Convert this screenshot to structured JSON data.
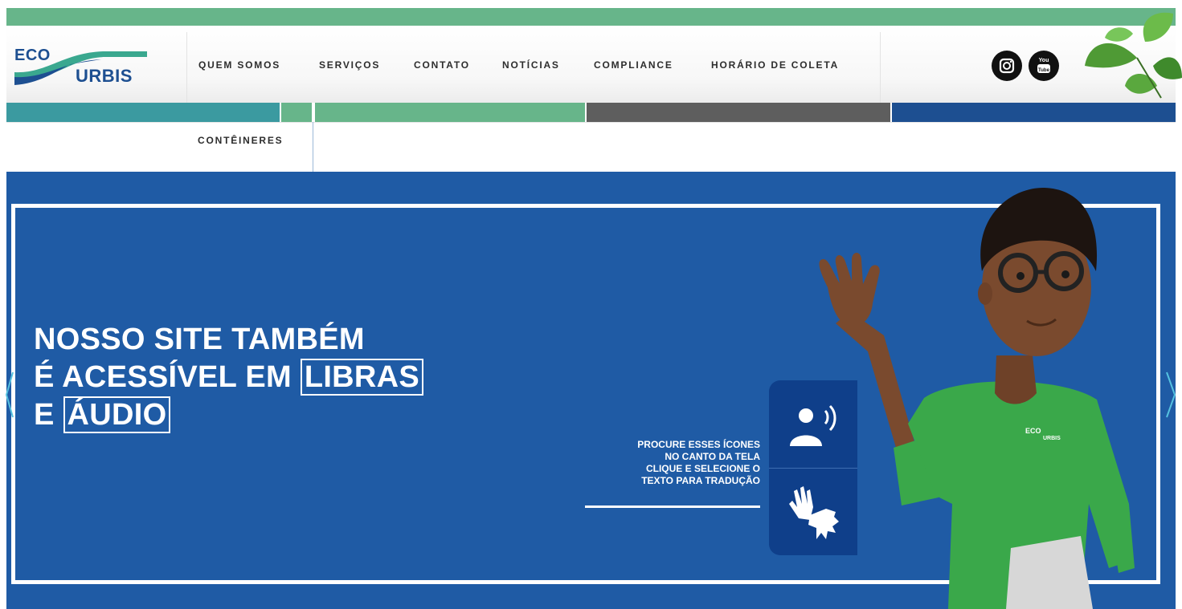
{
  "logo": {
    "line1": "ECO",
    "line2": "URBIS"
  },
  "nav": {
    "items": [
      {
        "label": "QUEM SOMOS"
      },
      {
        "label": "SERVIÇOS"
      },
      {
        "label": "CONTATO"
      },
      {
        "label": "NOTÍCIAS"
      },
      {
        "label": "COMPLIANCE"
      },
      {
        "label": "HORÁRIO DE COLETA"
      }
    ],
    "dropdown_item": "CONTÊINERES"
  },
  "social": {
    "instagram_icon": "instagram-icon",
    "youtube_icon": "youtube-icon",
    "youtube_text": "You Tube"
  },
  "hero": {
    "headline_line1": "NOSSO SITE TAMBÉM",
    "headline_line2_prefix": "É ACESSÍVEL EM ",
    "headline_line2_highlight": "LIBRAS",
    "headline_line3_prefix": "E ",
    "headline_line3_highlight": "ÁUDIO",
    "instruction_lines": [
      "PROCURE ESSES ÍCONES",
      "NO CANTO DA TELA",
      "CLIQUE E SELECIONE O",
      "TEXTO PARA TRADUÇÃO"
    ],
    "icons": [
      "audio-icon",
      "sign-language-icon"
    ],
    "shirt_logo": {
      "line1": "ECO",
      "line2": "URBIS"
    }
  },
  "colors": {
    "top_bar": "#67b58a",
    "hero_bg": "#1f5ba5",
    "icon_panel": "#0f3f8a",
    "band_teal": "#3b9aa0",
    "band_green": "#67b58a",
    "band_gray": "#5e5e5e",
    "band_blue": "#1d4f91",
    "text_dark": "#2d2d2d",
    "shirt_green": "#3aa84a"
  }
}
